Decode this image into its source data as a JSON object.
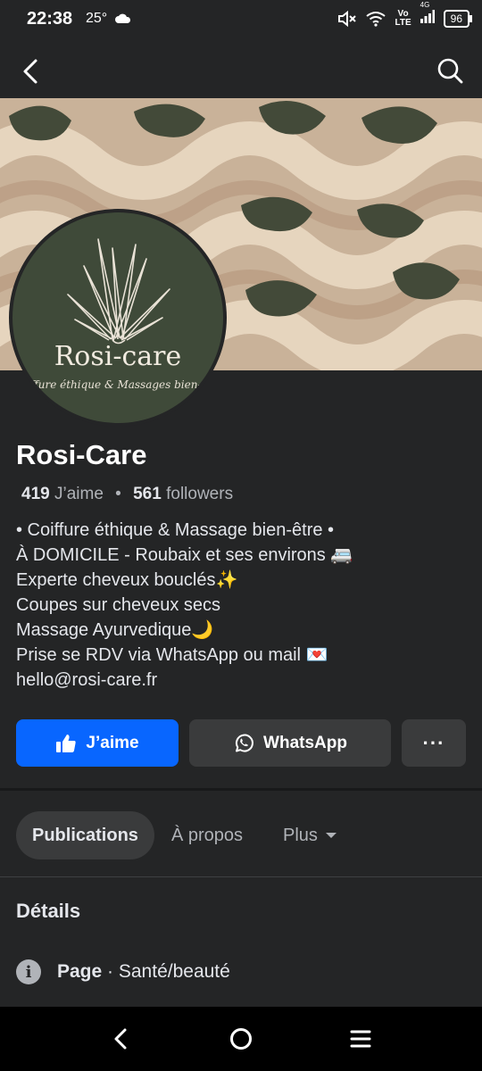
{
  "status_bar": {
    "time": "22:38",
    "temperature": "25°",
    "network_top": "Vo",
    "network_bottom": "LTE",
    "signal": "4G",
    "battery": "96"
  },
  "top_nav": {
    "back_icon": "arrow-left-icon",
    "search_icon": "search-icon"
  },
  "profile": {
    "avatar_brand": "Rosi-care",
    "avatar_tagline": "Coiffure éthique & Massages bien-être",
    "name": "Rosi-Care",
    "likes_count": "419",
    "likes_label": "J’aime",
    "separator": "•",
    "followers_count": "561",
    "followers_label": "followers",
    "bio_lines": [
      "• Coiffure éthique & Massage bien-être •",
      "À DOMICILE - Roubaix et ses environs 🚐",
      "Experte cheveux bouclés✨",
      "Coupes sur cheveux secs",
      "Massage Ayurvedique🌙",
      "Prise se RDV via WhatsApp ou mail 💌",
      "hello@rosi-care.fr"
    ]
  },
  "actions": {
    "like_label": "J’aime",
    "whatsapp_label": "WhatsApp",
    "more_label": "···"
  },
  "tabs": {
    "publications": "Publications",
    "about": "À propos",
    "more": "Plus"
  },
  "details": {
    "title": "Détails",
    "page_label": "Page",
    "page_separator": " · ",
    "page_category": "Santé/beauté"
  },
  "colors": {
    "background": "#242526",
    "primary_button": "#0866ff",
    "secondary_button": "#3a3b3c",
    "cover_base": "#c6ad94",
    "avatar_green": "#3f4a39"
  }
}
